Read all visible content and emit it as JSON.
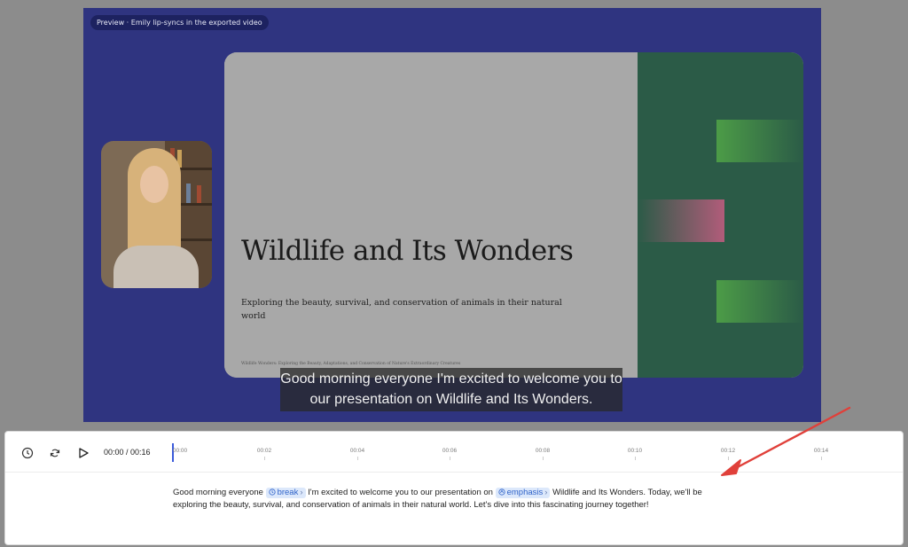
{
  "preview": {
    "badge": "Preview · Emily lip-syncs in the exported video",
    "slide": {
      "title": "Wildlife and Its Wonders",
      "subtitle": "Exploring the beauty, survival, and conservation of animals in their natural world",
      "footer": "Wildlife Wonders: Exploring the Beauty, Adaptations, and Conservation of Nature's Extraordinary Creatures"
    },
    "caption": "Good morning everyone I'm excited to welcome you to our presentation on Wildlife and Its Wonders."
  },
  "player": {
    "time": "00:00 / 00:16",
    "ticks": [
      "00:00",
      "00:02",
      "00:04",
      "00:06",
      "00:08",
      "00:10",
      "00:12",
      "00:14"
    ],
    "controls": {
      "history_icon": "clock-icon",
      "loop_icon": "refresh-icon",
      "play_icon": "play-icon"
    }
  },
  "script": {
    "part1": "Good morning everyone",
    "chip1": "break",
    "part2": "I'm excited to welcome you to our presentation on",
    "chip2": "emphasis",
    "part3": "Wildlife and Its Wonders. Today, we'll be exploring the beauty, survival, and conservation of animals in their natural world. Let's dive into this fascinating journey together!"
  },
  "colors": {
    "accent": "#3b5bdb",
    "chip_bg": "#dce8fb",
    "annotation_arrow": "#e0403a"
  }
}
